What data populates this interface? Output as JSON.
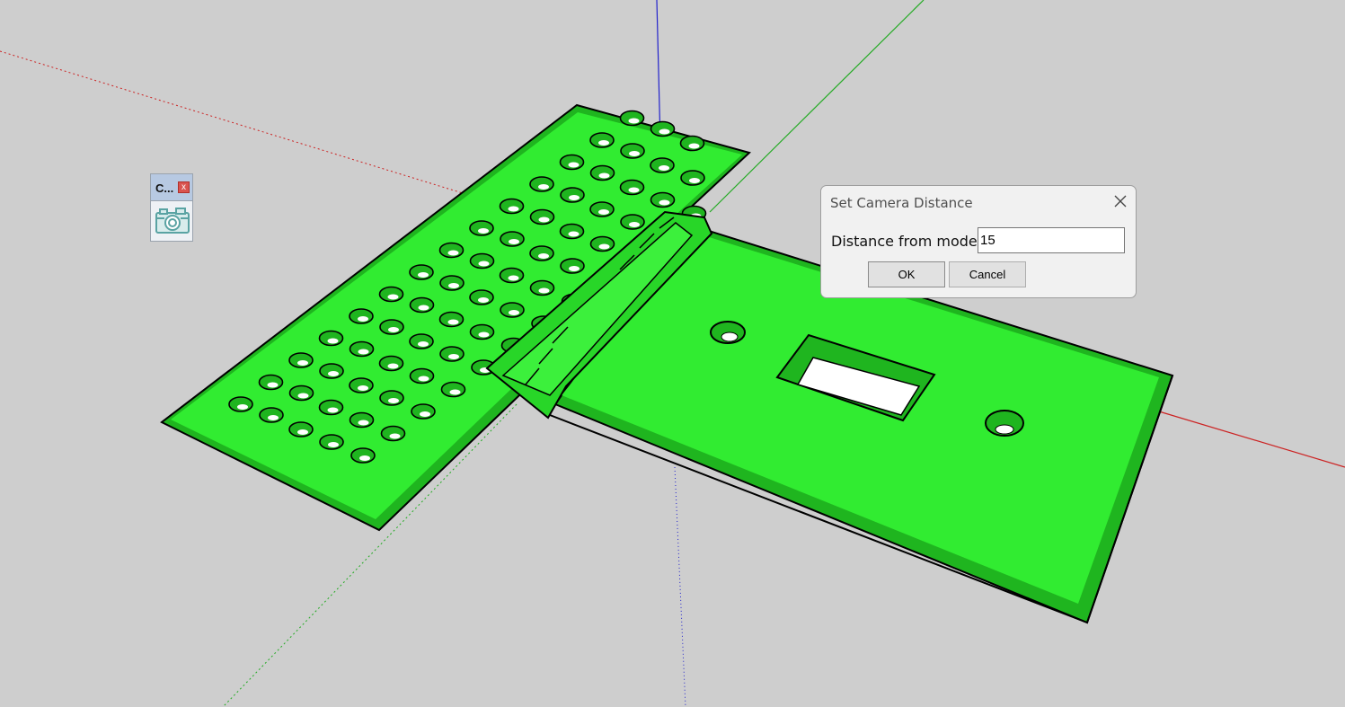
{
  "colors": {
    "background": "#cecece",
    "model_green": "#2ee62e",
    "model_green_dark": "#1fb51f",
    "axis_red": "#cc2222",
    "axis_green": "#22aa22",
    "axis_blue": "#2222cc"
  },
  "toolbar": {
    "title": "C...",
    "close_glyph": "x",
    "button_icon": "camera-icon"
  },
  "dialog": {
    "title": "Set Camera Distance",
    "close_icon": "close-icon",
    "field_label": "Distance from model:",
    "field_value": "15",
    "ok_label": "OK",
    "cancel_label": "Cancel"
  }
}
